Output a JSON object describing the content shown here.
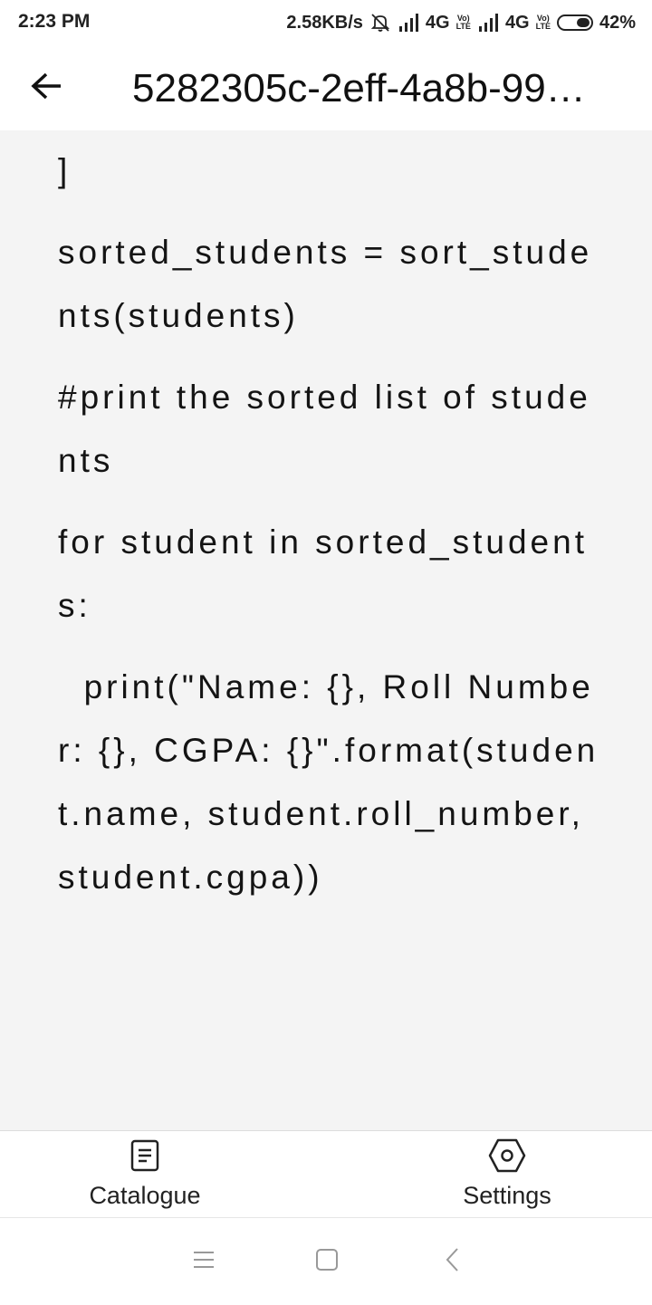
{
  "status_bar": {
    "time": "2:23 PM",
    "net_speed": "2.58KB/s",
    "network_1": "4G",
    "network_2": "4G",
    "volte_top": "Vo)",
    "volte_bottom": "LTE",
    "battery": "42%",
    "icons": [
      "mute-icon",
      "signal-icon",
      "signal-icon",
      "battery-icon"
    ]
  },
  "app_bar": {
    "title": "5282305c-2eff-4a8b-99…",
    "back_icon": "arrow-left-icon"
  },
  "content": {
    "lines": [
      "]",
      "sorted_students = sort_students(students)",
      "#print the sorted list of students",
      "for student in sorted_students:",
      "  print(\"Name: {}, Roll Number: {}, CGPA: {}\".format(student.name, student.roll_number, student.cgpa))"
    ]
  },
  "bottom_nav": {
    "items": [
      {
        "label": "Catalogue",
        "icon": "document-icon"
      },
      {
        "label": "Settings",
        "icon": "hexagon-settings-icon"
      }
    ]
  },
  "system_nav": {
    "icons": [
      "menu-icon",
      "home-square-icon",
      "back-chevron-icon"
    ]
  }
}
